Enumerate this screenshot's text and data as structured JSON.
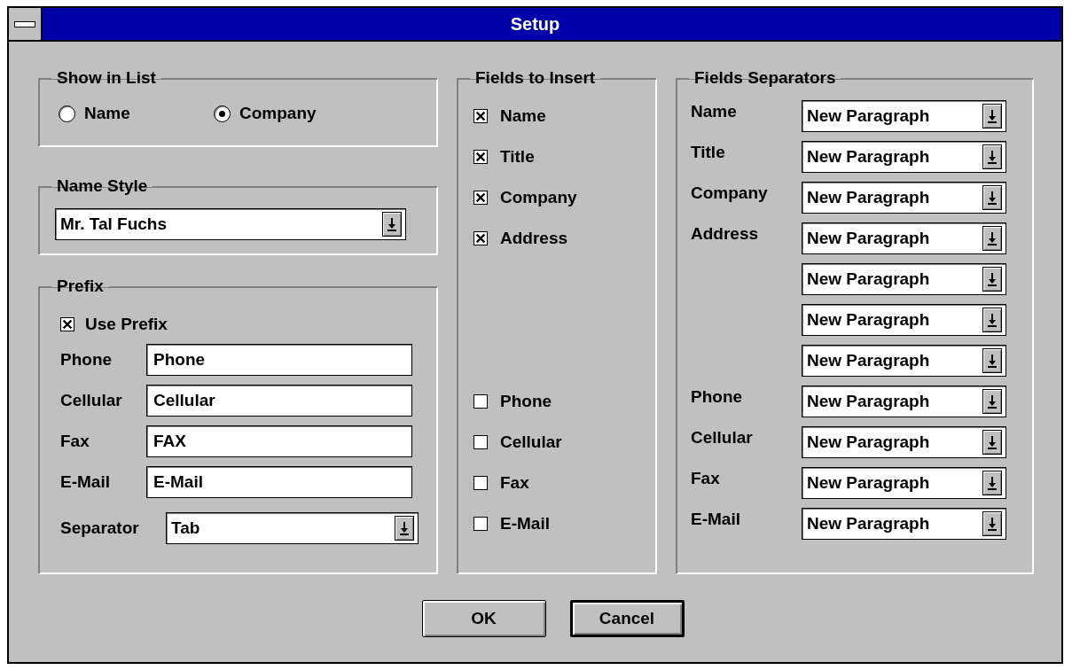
{
  "window": {
    "title": "Setup"
  },
  "show_in_list": {
    "title": "Show in List",
    "options": [
      {
        "label": "Name",
        "selected": false
      },
      {
        "label": "Company",
        "selected": true
      }
    ]
  },
  "name_style": {
    "title": "Name Style",
    "value": "Mr. Tal Fuchs"
  },
  "prefix": {
    "title": "Prefix",
    "use_prefix": {
      "label": "Use Prefix",
      "checked": true
    },
    "fields": [
      {
        "label": "Phone",
        "value": "Phone"
      },
      {
        "label": "Cellular",
        "value": "Cellular"
      },
      {
        "label": "Fax",
        "value": "FAX"
      },
      {
        "label": "E-Mail",
        "value": "E-Mail"
      }
    ],
    "separator": {
      "label": "Separator",
      "value": "Tab"
    }
  },
  "fields_to_insert": {
    "title": "Fields to Insert",
    "items": [
      {
        "label": "Name",
        "checked": true
      },
      {
        "label": "Title",
        "checked": true
      },
      {
        "label": "Company",
        "checked": true
      },
      {
        "label": "Address",
        "checked": true
      }
    ],
    "more_items": [
      {
        "label": "Phone",
        "checked": false
      },
      {
        "label": "Cellular",
        "checked": false
      },
      {
        "label": "Fax",
        "checked": false
      },
      {
        "label": "E-Mail",
        "checked": false
      }
    ]
  },
  "fields_separators": {
    "title": "Fields Separators",
    "rows": [
      {
        "label": "Name",
        "value": "New Paragraph"
      },
      {
        "label": "Title",
        "value": "New Paragraph"
      },
      {
        "label": "Company",
        "value": "New Paragraph"
      },
      {
        "label": "Address",
        "value": "New Paragraph"
      },
      {
        "value": "New Paragraph"
      },
      {
        "value": "New Paragraph"
      },
      {
        "value": "New Paragraph"
      },
      {
        "label": "Phone",
        "value": "New Paragraph"
      },
      {
        "label": "Cellular",
        "value": "New Paragraph"
      },
      {
        "label": "Fax",
        "value": "New Paragraph"
      },
      {
        "label": "E-Mail",
        "value": "New Paragraph"
      }
    ]
  },
  "buttons": [
    {
      "label": "OK",
      "default": false
    },
    {
      "label": "Cancel",
      "default": true
    }
  ]
}
